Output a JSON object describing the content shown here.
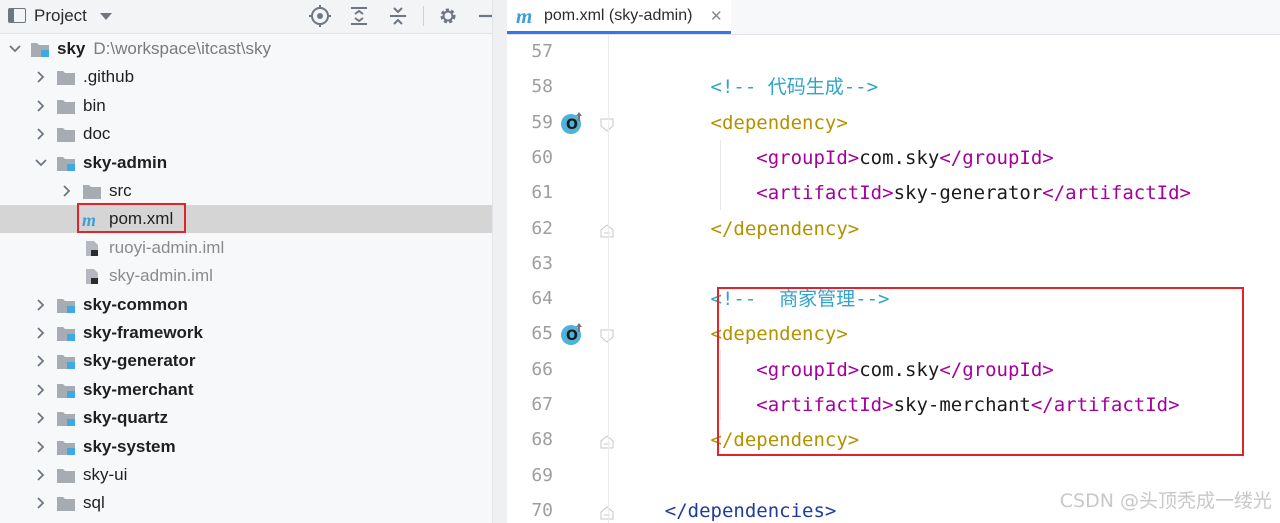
{
  "project_panel": {
    "title": "Project",
    "toolbar_icons": [
      "locate-icon",
      "expand-all-icon",
      "collapse-all-icon",
      "gear-icon",
      "minimize-icon"
    ]
  },
  "tree": [
    {
      "label": "sky",
      "path": "D:\\workspace\\itcast\\sky",
      "bold": true,
      "expanded": true,
      "indent": 0,
      "icon": "module-folder-icon"
    },
    {
      "label": ".github",
      "bold": false,
      "expanded": false,
      "indent": 1,
      "icon": "folder-icon"
    },
    {
      "label": "bin",
      "bold": false,
      "expanded": false,
      "indent": 1,
      "icon": "folder-icon"
    },
    {
      "label": "doc",
      "bold": false,
      "expanded": false,
      "indent": 1,
      "icon": "folder-icon"
    },
    {
      "label": "sky-admin",
      "bold": true,
      "expanded": true,
      "indent": 1,
      "icon": "module-folder-icon"
    },
    {
      "label": "src",
      "bold": false,
      "expanded": false,
      "indent": 2,
      "icon": "folder-icon"
    },
    {
      "label": "pom.xml",
      "bold": false,
      "selected": true,
      "indent": 2,
      "icon": "maven-icon",
      "leaf": true
    },
    {
      "label": "ruoyi-admin.iml",
      "bold": false,
      "muted": true,
      "indent": 2,
      "icon": "iml-file-icon",
      "leaf": true
    },
    {
      "label": "sky-admin.iml",
      "bold": false,
      "muted": true,
      "indent": 2,
      "icon": "iml-file-icon",
      "leaf": true
    },
    {
      "label": "sky-common",
      "bold": true,
      "expanded": false,
      "indent": 1,
      "icon": "module-folder-icon"
    },
    {
      "label": "sky-framework",
      "bold": true,
      "expanded": false,
      "indent": 1,
      "icon": "module-folder-icon"
    },
    {
      "label": "sky-generator",
      "bold": true,
      "expanded": false,
      "indent": 1,
      "icon": "module-folder-icon"
    },
    {
      "label": "sky-merchant",
      "bold": true,
      "expanded": false,
      "indent": 1,
      "icon": "module-folder-icon"
    },
    {
      "label": "sky-quartz",
      "bold": true,
      "expanded": false,
      "indent": 1,
      "icon": "module-folder-icon"
    },
    {
      "label": "sky-system",
      "bold": true,
      "expanded": false,
      "indent": 1,
      "icon": "module-folder-icon"
    },
    {
      "label": "sky-ui",
      "bold": false,
      "expanded": false,
      "indent": 1,
      "icon": "folder-icon"
    },
    {
      "label": "sql",
      "bold": false,
      "expanded": false,
      "indent": 1,
      "icon": "folder-icon"
    }
  ],
  "editor": {
    "tab": {
      "icon": "m",
      "label": "pom.xml (sky-admin)"
    },
    "lines": [
      {
        "n": "57",
        "tokens": []
      },
      {
        "n": "58",
        "tokens": [
          {
            "t": "        "
          },
          {
            "t": "<!-- 代码生成-->",
            "c": "cmt"
          }
        ]
      },
      {
        "n": "59",
        "override": true,
        "fold": "open",
        "tokens": [
          {
            "t": "        "
          },
          {
            "t": "<dependency>",
            "c": "bracket-y"
          }
        ]
      },
      {
        "n": "60",
        "tokens": [
          {
            "t": "            "
          },
          {
            "t": "<groupId>",
            "c": "tag"
          },
          {
            "t": "com.sky",
            "c": "txt"
          },
          {
            "t": "</groupId>",
            "c": "tag"
          }
        ]
      },
      {
        "n": "61",
        "tokens": [
          {
            "t": "            "
          },
          {
            "t": "<artifactId>",
            "c": "tag"
          },
          {
            "t": "sky-generator",
            "c": "txt"
          },
          {
            "t": "</artifactId>",
            "c": "tag"
          }
        ]
      },
      {
        "n": "62",
        "fold": "close",
        "tokens": [
          {
            "t": "        "
          },
          {
            "t": "</dependency>",
            "c": "bracket-y"
          }
        ]
      },
      {
        "n": "63",
        "tokens": []
      },
      {
        "n": "64",
        "tokens": [
          {
            "t": "        "
          },
          {
            "t": "<!--  商家管理-->",
            "c": "cmt"
          }
        ]
      },
      {
        "n": "65",
        "override": true,
        "fold": "open",
        "tokens": [
          {
            "t": "        "
          },
          {
            "t": "<dependency>",
            "c": "bracket-y"
          }
        ]
      },
      {
        "n": "66",
        "tokens": [
          {
            "t": "            "
          },
          {
            "t": "<groupId>",
            "c": "tag"
          },
          {
            "t": "com.sky",
            "c": "txt"
          },
          {
            "t": "</groupId>",
            "c": "tag"
          }
        ]
      },
      {
        "n": "67",
        "tokens": [
          {
            "t": "            "
          },
          {
            "t": "<artifactId>",
            "c": "tag"
          },
          {
            "t": "sky-merchant",
            "c": "txt"
          },
          {
            "t": "</artifactId>",
            "c": "tag"
          }
        ]
      },
      {
        "n": "68",
        "fold": "close",
        "tokens": [
          {
            "t": "        "
          },
          {
            "t": "</dependency>",
            "c": "bracket-y"
          }
        ]
      },
      {
        "n": "69",
        "tokens": []
      },
      {
        "n": "70",
        "fold": "close",
        "tokens": [
          {
            "t": "    "
          },
          {
            "t": "</dependencies>",
            "c": "tagb"
          }
        ]
      }
    ]
  },
  "watermark": "CSDN @头顶秃成一缕光",
  "colors": {
    "highlight": "#e0242b",
    "accent": "#3574f0",
    "comment": "#2fa4c9",
    "tag": "#a5009e"
  }
}
